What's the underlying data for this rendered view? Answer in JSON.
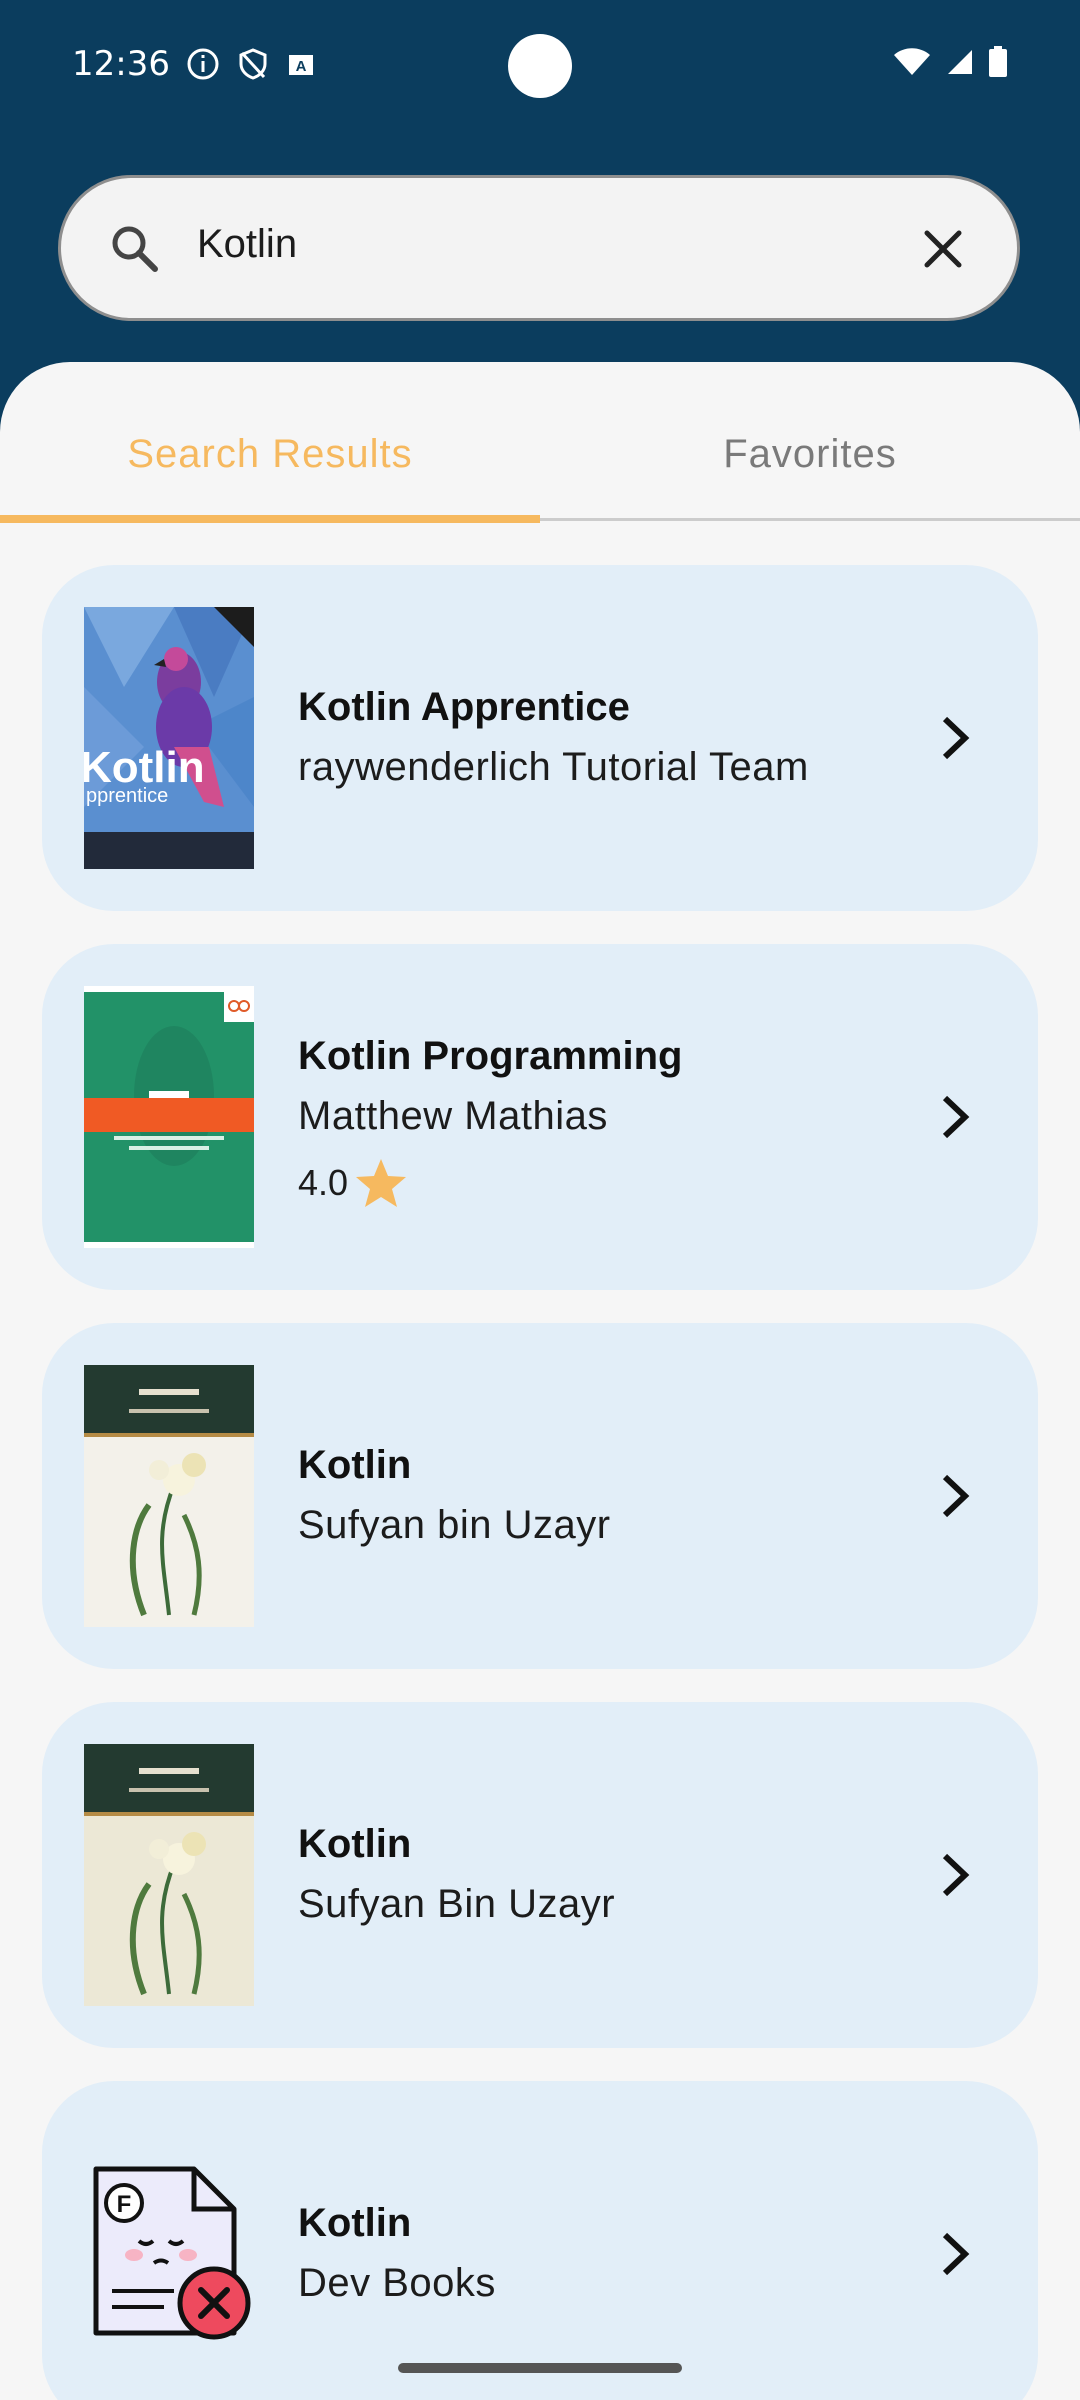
{
  "status_bar": {
    "time": "12:36"
  },
  "search": {
    "value": "Kotlin"
  },
  "tabs": [
    {
      "label": "Search Results",
      "active": true
    },
    {
      "label": "Favorites",
      "active": false
    }
  ],
  "results": [
    {
      "title": "Kotlin Apprentice",
      "author": "raywenderlich Tutorial Team",
      "rating": null
    },
    {
      "title": "Kotlin Programming",
      "author": "Matthew Mathias",
      "rating": "4.0"
    },
    {
      "title": "Kotlin",
      "author": "Sufyan bin Uzayr",
      "rating": null
    },
    {
      "title": "Kotlin",
      "author": "Sufyan Bin Uzayr",
      "rating": null
    },
    {
      "title": "Kotlin",
      "author": "Dev Books",
      "rating": null
    }
  ],
  "colors": {
    "header": "#0b3d5e",
    "accent": "#f6b95f",
    "card": "#e2eef8",
    "background": "#f6f6f6"
  }
}
